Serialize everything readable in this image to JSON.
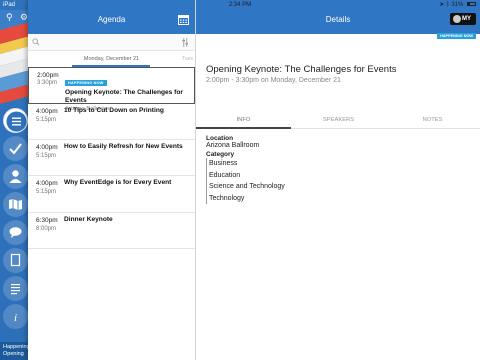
{
  "status_bar": {
    "device": "iPad",
    "time": "2:34 PM",
    "battery": "31%"
  },
  "colors": {
    "header_blue": "#2f76c5",
    "badge_blue": "#2aa1d8",
    "rail_blue": "#2f73bd"
  },
  "nav_rail": {
    "items": [
      "menu-icon",
      "check-icon",
      "person-icon",
      "map-icon",
      "chat-icon",
      "document-icon",
      "list-icon",
      "info-icon"
    ],
    "footer_line1": "Happening",
    "footer_line2": "Opening"
  },
  "agenda": {
    "title": "Agenda",
    "search": {
      "placeholder": "",
      "value": ""
    },
    "day": "Monday, December 21",
    "next_day": "Tues",
    "sessions": [
      {
        "start": "2:00pm",
        "end": "3:30pm",
        "badge": "HAPPENING NOW",
        "title": "Opening Keynote: The Challenges for Events",
        "location": "Arizona Ballroom"
      },
      {
        "start": "4:00pm",
        "end": "5:15pm",
        "title": "10 Tips to Cut Down on Printing"
      },
      {
        "start": "4:00pm",
        "end": "5:15pm",
        "title": "How to Easily Refresh for New Events"
      },
      {
        "start": "4:00pm",
        "end": "5:15pm",
        "title": "Why EventEdge is for Every Event"
      },
      {
        "start": "6:30pm",
        "end": "8:00pm",
        "title": "Dinner Keynote"
      }
    ]
  },
  "details": {
    "title": "Details",
    "my_label": "MY",
    "badge": "HAPPENING NOW",
    "event_title": "Opening Keynote: The Challenges for Events",
    "event_when": "2:00pm - 3:30pm on Monday, December 21",
    "tabs": [
      "INFO",
      "SPEAKERS",
      "NOTES"
    ],
    "location_label": "Location",
    "location": "Arizona Ballroom",
    "category_label": "Category",
    "categories": [
      "Business",
      "Education",
      "Science and Technology",
      "Technology"
    ]
  }
}
